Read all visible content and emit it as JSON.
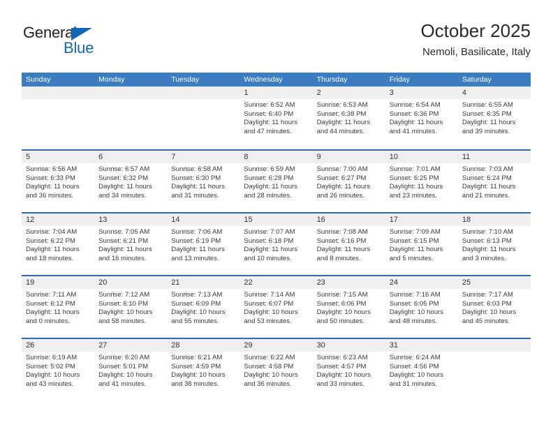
{
  "brand": {
    "name_top": "General",
    "name_bottom": "Blue",
    "triangle_color": "#1467b3"
  },
  "header": {
    "title": "October 2025",
    "subtitle": "Nemoli, Basilicate, Italy"
  },
  "theme": {
    "header_blue": "#3b7dc0",
    "row_divider_blue": "#2a6cb0",
    "day_band_gray": "#efefef"
  },
  "weekdays": [
    "Sunday",
    "Monday",
    "Tuesday",
    "Wednesday",
    "Thursday",
    "Friday",
    "Saturday"
  ],
  "weeks": [
    [
      {
        "day": "",
        "lines": []
      },
      {
        "day": "",
        "lines": []
      },
      {
        "day": "",
        "lines": []
      },
      {
        "day": "1",
        "lines": [
          "Sunrise: 6:52 AM",
          "Sunset: 6:40 PM",
          "Daylight: 11 hours",
          "and 47 minutes."
        ]
      },
      {
        "day": "2",
        "lines": [
          "Sunrise: 6:53 AM",
          "Sunset: 6:38 PM",
          "Daylight: 11 hours",
          "and 44 minutes."
        ]
      },
      {
        "day": "3",
        "lines": [
          "Sunrise: 6:54 AM",
          "Sunset: 6:36 PM",
          "Daylight: 11 hours",
          "and 41 minutes."
        ]
      },
      {
        "day": "4",
        "lines": [
          "Sunrise: 6:55 AM",
          "Sunset: 6:35 PM",
          "Daylight: 11 hours",
          "and 39 minutes."
        ]
      }
    ],
    [
      {
        "day": "5",
        "lines": [
          "Sunrise: 6:56 AM",
          "Sunset: 6:33 PM",
          "Daylight: 11 hours",
          "and 36 minutes."
        ]
      },
      {
        "day": "6",
        "lines": [
          "Sunrise: 6:57 AM",
          "Sunset: 6:32 PM",
          "Daylight: 11 hours",
          "and 34 minutes."
        ]
      },
      {
        "day": "7",
        "lines": [
          "Sunrise: 6:58 AM",
          "Sunset: 6:30 PM",
          "Daylight: 11 hours",
          "and 31 minutes."
        ]
      },
      {
        "day": "8",
        "lines": [
          "Sunrise: 6:59 AM",
          "Sunset: 6:28 PM",
          "Daylight: 11 hours",
          "and 28 minutes."
        ]
      },
      {
        "day": "9",
        "lines": [
          "Sunrise: 7:00 AM",
          "Sunset: 6:27 PM",
          "Daylight: 11 hours",
          "and 26 minutes."
        ]
      },
      {
        "day": "10",
        "lines": [
          "Sunrise: 7:01 AM",
          "Sunset: 6:25 PM",
          "Daylight: 11 hours",
          "and 23 minutes."
        ]
      },
      {
        "day": "11",
        "lines": [
          "Sunrise: 7:03 AM",
          "Sunset: 6:24 PM",
          "Daylight: 11 hours",
          "and 21 minutes."
        ]
      }
    ],
    [
      {
        "day": "12",
        "lines": [
          "Sunrise: 7:04 AM",
          "Sunset: 6:22 PM",
          "Daylight: 11 hours",
          "and 18 minutes."
        ]
      },
      {
        "day": "13",
        "lines": [
          "Sunrise: 7:05 AM",
          "Sunset: 6:21 PM",
          "Daylight: 11 hours",
          "and 16 minutes."
        ]
      },
      {
        "day": "14",
        "lines": [
          "Sunrise: 7:06 AM",
          "Sunset: 6:19 PM",
          "Daylight: 11 hours",
          "and 13 minutes."
        ]
      },
      {
        "day": "15",
        "lines": [
          "Sunrise: 7:07 AM",
          "Sunset: 6:18 PM",
          "Daylight: 11 hours",
          "and 10 minutes."
        ]
      },
      {
        "day": "16",
        "lines": [
          "Sunrise: 7:08 AM",
          "Sunset: 6:16 PM",
          "Daylight: 11 hours",
          "and 8 minutes."
        ]
      },
      {
        "day": "17",
        "lines": [
          "Sunrise: 7:09 AM",
          "Sunset: 6:15 PM",
          "Daylight: 11 hours",
          "and 5 minutes."
        ]
      },
      {
        "day": "18",
        "lines": [
          "Sunrise: 7:10 AM",
          "Sunset: 6:13 PM",
          "Daylight: 11 hours",
          "and 3 minutes."
        ]
      }
    ],
    [
      {
        "day": "19",
        "lines": [
          "Sunrise: 7:11 AM",
          "Sunset: 6:12 PM",
          "Daylight: 11 hours",
          "and 0 minutes."
        ]
      },
      {
        "day": "20",
        "lines": [
          "Sunrise: 7:12 AM",
          "Sunset: 6:10 PM",
          "Daylight: 10 hours",
          "and 58 minutes."
        ]
      },
      {
        "day": "21",
        "lines": [
          "Sunrise: 7:13 AM",
          "Sunset: 6:09 PM",
          "Daylight: 10 hours",
          "and 55 minutes."
        ]
      },
      {
        "day": "22",
        "lines": [
          "Sunrise: 7:14 AM",
          "Sunset: 6:07 PM",
          "Daylight: 10 hours",
          "and 53 minutes."
        ]
      },
      {
        "day": "23",
        "lines": [
          "Sunrise: 7:15 AM",
          "Sunset: 6:06 PM",
          "Daylight: 10 hours",
          "and 50 minutes."
        ]
      },
      {
        "day": "24",
        "lines": [
          "Sunrise: 7:16 AM",
          "Sunset: 6:05 PM",
          "Daylight: 10 hours",
          "and 48 minutes."
        ]
      },
      {
        "day": "25",
        "lines": [
          "Sunrise: 7:17 AM",
          "Sunset: 6:03 PM",
          "Daylight: 10 hours",
          "and 45 minutes."
        ]
      }
    ],
    [
      {
        "day": "26",
        "lines": [
          "Sunrise: 6:19 AM",
          "Sunset: 5:02 PM",
          "Daylight: 10 hours",
          "and 43 minutes."
        ]
      },
      {
        "day": "27",
        "lines": [
          "Sunrise: 6:20 AM",
          "Sunset: 5:01 PM",
          "Daylight: 10 hours",
          "and 41 minutes."
        ]
      },
      {
        "day": "28",
        "lines": [
          "Sunrise: 6:21 AM",
          "Sunset: 4:59 PM",
          "Daylight: 10 hours",
          "and 38 minutes."
        ]
      },
      {
        "day": "29",
        "lines": [
          "Sunrise: 6:22 AM",
          "Sunset: 4:58 PM",
          "Daylight: 10 hours",
          "and 36 minutes."
        ]
      },
      {
        "day": "30",
        "lines": [
          "Sunrise: 6:23 AM",
          "Sunset: 4:57 PM",
          "Daylight: 10 hours",
          "and 33 minutes."
        ]
      },
      {
        "day": "31",
        "lines": [
          "Sunrise: 6:24 AM",
          "Sunset: 4:56 PM",
          "Daylight: 10 hours",
          "and 31 minutes."
        ]
      },
      {
        "day": "",
        "lines": []
      }
    ]
  ]
}
